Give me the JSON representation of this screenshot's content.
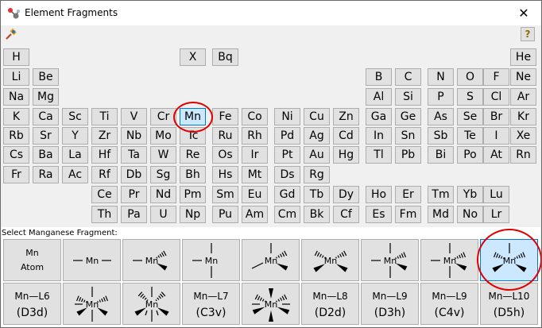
{
  "window": {
    "title": "Element Fragments",
    "close_symbol": "✕"
  },
  "toolbar": {
    "help_label": "?"
  },
  "elements": [
    {
      "s": "H",
      "r": 0,
      "c": 0
    },
    {
      "s": "X",
      "r": 0,
      "c": 6
    },
    {
      "s": "Bq",
      "r": 0,
      "c": 7
    },
    {
      "s": "He",
      "r": 0,
      "c": 17
    },
    {
      "s": "Li",
      "r": 1,
      "c": 0
    },
    {
      "s": "Be",
      "r": 1,
      "c": 1
    },
    {
      "s": "B",
      "r": 1,
      "c": 12
    },
    {
      "s": "C",
      "r": 1,
      "c": 13
    },
    {
      "s": "N",
      "r": 1,
      "c": 14
    },
    {
      "s": "O",
      "r": 1,
      "c": 15
    },
    {
      "s": "F",
      "r": 1,
      "c": 16
    },
    {
      "s": "Ne",
      "r": 1,
      "c": 17
    },
    {
      "s": "Na",
      "r": 2,
      "c": 0
    },
    {
      "s": "Mg",
      "r": 2,
      "c": 1
    },
    {
      "s": "Al",
      "r": 2,
      "c": 12
    },
    {
      "s": "Si",
      "r": 2,
      "c": 13
    },
    {
      "s": "P",
      "r": 2,
      "c": 14
    },
    {
      "s": "S",
      "r": 2,
      "c": 15
    },
    {
      "s": "Cl",
      "r": 2,
      "c": 16
    },
    {
      "s": "Ar",
      "r": 2,
      "c": 17
    },
    {
      "s": "K",
      "r": 3,
      "c": 0
    },
    {
      "s": "Ca",
      "r": 3,
      "c": 1
    },
    {
      "s": "Sc",
      "r": 3,
      "c": 2
    },
    {
      "s": "Ti",
      "r": 3,
      "c": 3
    },
    {
      "s": "V",
      "r": 3,
      "c": 4
    },
    {
      "s": "Cr",
      "r": 3,
      "c": 5
    },
    {
      "s": "Mn",
      "r": 3,
      "c": 6,
      "selected": true
    },
    {
      "s": "Fe",
      "r": 3,
      "c": 7
    },
    {
      "s": "Co",
      "r": 3,
      "c": 8
    },
    {
      "s": "Ni",
      "r": 3,
      "c": 9
    },
    {
      "s": "Cu",
      "r": 3,
      "c": 10
    },
    {
      "s": "Zn",
      "r": 3,
      "c": 11
    },
    {
      "s": "Ga",
      "r": 3,
      "c": 12
    },
    {
      "s": "Ge",
      "r": 3,
      "c": 13
    },
    {
      "s": "As",
      "r": 3,
      "c": 14
    },
    {
      "s": "Se",
      "r": 3,
      "c": 15
    },
    {
      "s": "Br",
      "r": 3,
      "c": 16
    },
    {
      "s": "Kr",
      "r": 3,
      "c": 17
    },
    {
      "s": "Rb",
      "r": 4,
      "c": 0
    },
    {
      "s": "Sr",
      "r": 4,
      "c": 1
    },
    {
      "s": "Y",
      "r": 4,
      "c": 2
    },
    {
      "s": "Zr",
      "r": 4,
      "c": 3
    },
    {
      "s": "Nb",
      "r": 4,
      "c": 4
    },
    {
      "s": "Mo",
      "r": 4,
      "c": 5
    },
    {
      "s": "Tc",
      "r": 4,
      "c": 6
    },
    {
      "s": "Ru",
      "r": 4,
      "c": 7
    },
    {
      "s": "Rh",
      "r": 4,
      "c": 8
    },
    {
      "s": "Pd",
      "r": 4,
      "c": 9
    },
    {
      "s": "Ag",
      "r": 4,
      "c": 10
    },
    {
      "s": "Cd",
      "r": 4,
      "c": 11
    },
    {
      "s": "In",
      "r": 4,
      "c": 12
    },
    {
      "s": "Sn",
      "r": 4,
      "c": 13
    },
    {
      "s": "Sb",
      "r": 4,
      "c": 14
    },
    {
      "s": "Te",
      "r": 4,
      "c": 15
    },
    {
      "s": "I",
      "r": 4,
      "c": 16
    },
    {
      "s": "Xe",
      "r": 4,
      "c": 17
    },
    {
      "s": "Cs",
      "r": 5,
      "c": 0
    },
    {
      "s": "Ba",
      "r": 5,
      "c": 1
    },
    {
      "s": "La",
      "r": 5,
      "c": 2
    },
    {
      "s": "Hf",
      "r": 5,
      "c": 3
    },
    {
      "s": "Ta",
      "r": 5,
      "c": 4
    },
    {
      "s": "W",
      "r": 5,
      "c": 5
    },
    {
      "s": "Re",
      "r": 5,
      "c": 6
    },
    {
      "s": "Os",
      "r": 5,
      "c": 7
    },
    {
      "s": "Ir",
      "r": 5,
      "c": 8
    },
    {
      "s": "Pt",
      "r": 5,
      "c": 9
    },
    {
      "s": "Au",
      "r": 5,
      "c": 10
    },
    {
      "s": "Hg",
      "r": 5,
      "c": 11
    },
    {
      "s": "Tl",
      "r": 5,
      "c": 12
    },
    {
      "s": "Pb",
      "r": 5,
      "c": 13
    },
    {
      "s": "Bi",
      "r": 5,
      "c": 14
    },
    {
      "s": "Po",
      "r": 5,
      "c": 15
    },
    {
      "s": "At",
      "r": 5,
      "c": 16
    },
    {
      "s": "Rn",
      "r": 5,
      "c": 17
    },
    {
      "s": "Fr",
      "r": 6,
      "c": 0
    },
    {
      "s": "Ra",
      "r": 6,
      "c": 1
    },
    {
      "s": "Ac",
      "r": 6,
      "c": 2
    },
    {
      "s": "Rf",
      "r": 6,
      "c": 3
    },
    {
      "s": "Db",
      "r": 6,
      "c": 4
    },
    {
      "s": "Sg",
      "r": 6,
      "c": 5
    },
    {
      "s": "Bh",
      "r": 6,
      "c": 6
    },
    {
      "s": "Hs",
      "r": 6,
      "c": 7
    },
    {
      "s": "Mt",
      "r": 6,
      "c": 8
    },
    {
      "s": "Ds",
      "r": 6,
      "c": 9
    },
    {
      "s": "Rg",
      "r": 6,
      "c": 10
    },
    {
      "s": "Ce",
      "r": 7,
      "c": 3
    },
    {
      "s": "Pr",
      "r": 7,
      "c": 4
    },
    {
      "s": "Nd",
      "r": 7,
      "c": 5
    },
    {
      "s": "Pm",
      "r": 7,
      "c": 6
    },
    {
      "s": "Sm",
      "r": 7,
      "c": 7
    },
    {
      "s": "Eu",
      "r": 7,
      "c": 8
    },
    {
      "s": "Gd",
      "r": 7,
      "c": 9
    },
    {
      "s": "Tb",
      "r": 7,
      "c": 10
    },
    {
      "s": "Dy",
      "r": 7,
      "c": 11
    },
    {
      "s": "Ho",
      "r": 7,
      "c": 12
    },
    {
      "s": "Er",
      "r": 7,
      "c": 13
    },
    {
      "s": "Tm",
      "r": 7,
      "c": 14
    },
    {
      "s": "Yb",
      "r": 7,
      "c": 15
    },
    {
      "s": "Lu",
      "r": 7,
      "c": 16
    },
    {
      "s": "Th",
      "r": 8,
      "c": 3
    },
    {
      "s": "Pa",
      "r": 8,
      "c": 4
    },
    {
      "s": "U",
      "r": 8,
      "c": 5
    },
    {
      "s": "Np",
      "r": 8,
      "c": 6
    },
    {
      "s": "Pu",
      "r": 8,
      "c": 7
    },
    {
      "s": "Am",
      "r": 8,
      "c": 8
    },
    {
      "s": "Cm",
      "r": 8,
      "c": 9
    },
    {
      "s": "Bk",
      "r": 8,
      "c": 10
    },
    {
      "s": "Cf",
      "r": 8,
      "c": 11
    },
    {
      "s": "Es",
      "r": 8,
      "c": 12
    },
    {
      "s": "Fm",
      "r": 8,
      "c": 13
    },
    {
      "s": "Md",
      "r": 8,
      "c": 14
    },
    {
      "s": "No",
      "r": 8,
      "c": 15
    },
    {
      "s": "Lr",
      "r": 8,
      "c": 16
    }
  ],
  "fragments": {
    "label": "Select Manganese Fragment:",
    "atom_symbol": "Mn",
    "atom_label": "Atom",
    "row1": [
      "atom",
      "linear",
      "trigonal-planar",
      "t-shaped",
      "tetrahedral",
      "square-planar",
      "trigonal-bipyramidal",
      "seesaw",
      "square-pyramidal"
    ],
    "row2": [
      {
        "kind": "text",
        "geo": "Mn—L6",
        "sym": "(D3d)"
      },
      {
        "kind": "icon",
        "name": "pentagonal-bipyramidal"
      },
      {
        "kind": "icon",
        "name": "capped-octahedral"
      },
      {
        "kind": "text",
        "geo": "Mn—L7",
        "sym": "(C3v)"
      },
      {
        "kind": "icon",
        "name": "dodecahedral"
      },
      {
        "kind": "text",
        "geo": "Mn—L8",
        "sym": "(D2d)"
      },
      {
        "kind": "text",
        "geo": "Mn—L9",
        "sym": "(D3h)"
      },
      {
        "kind": "text",
        "geo": "Mn—L9",
        "sym": "(C4v)"
      },
      {
        "kind": "text",
        "geo": "Mn—L10",
        "sym": "(D5h)"
      }
    ],
    "selected_row1_index": 8
  },
  "colors": {
    "highlight": "#e00000",
    "selected_bg": "#cce8ff",
    "selected_border": "#0078d7"
  }
}
